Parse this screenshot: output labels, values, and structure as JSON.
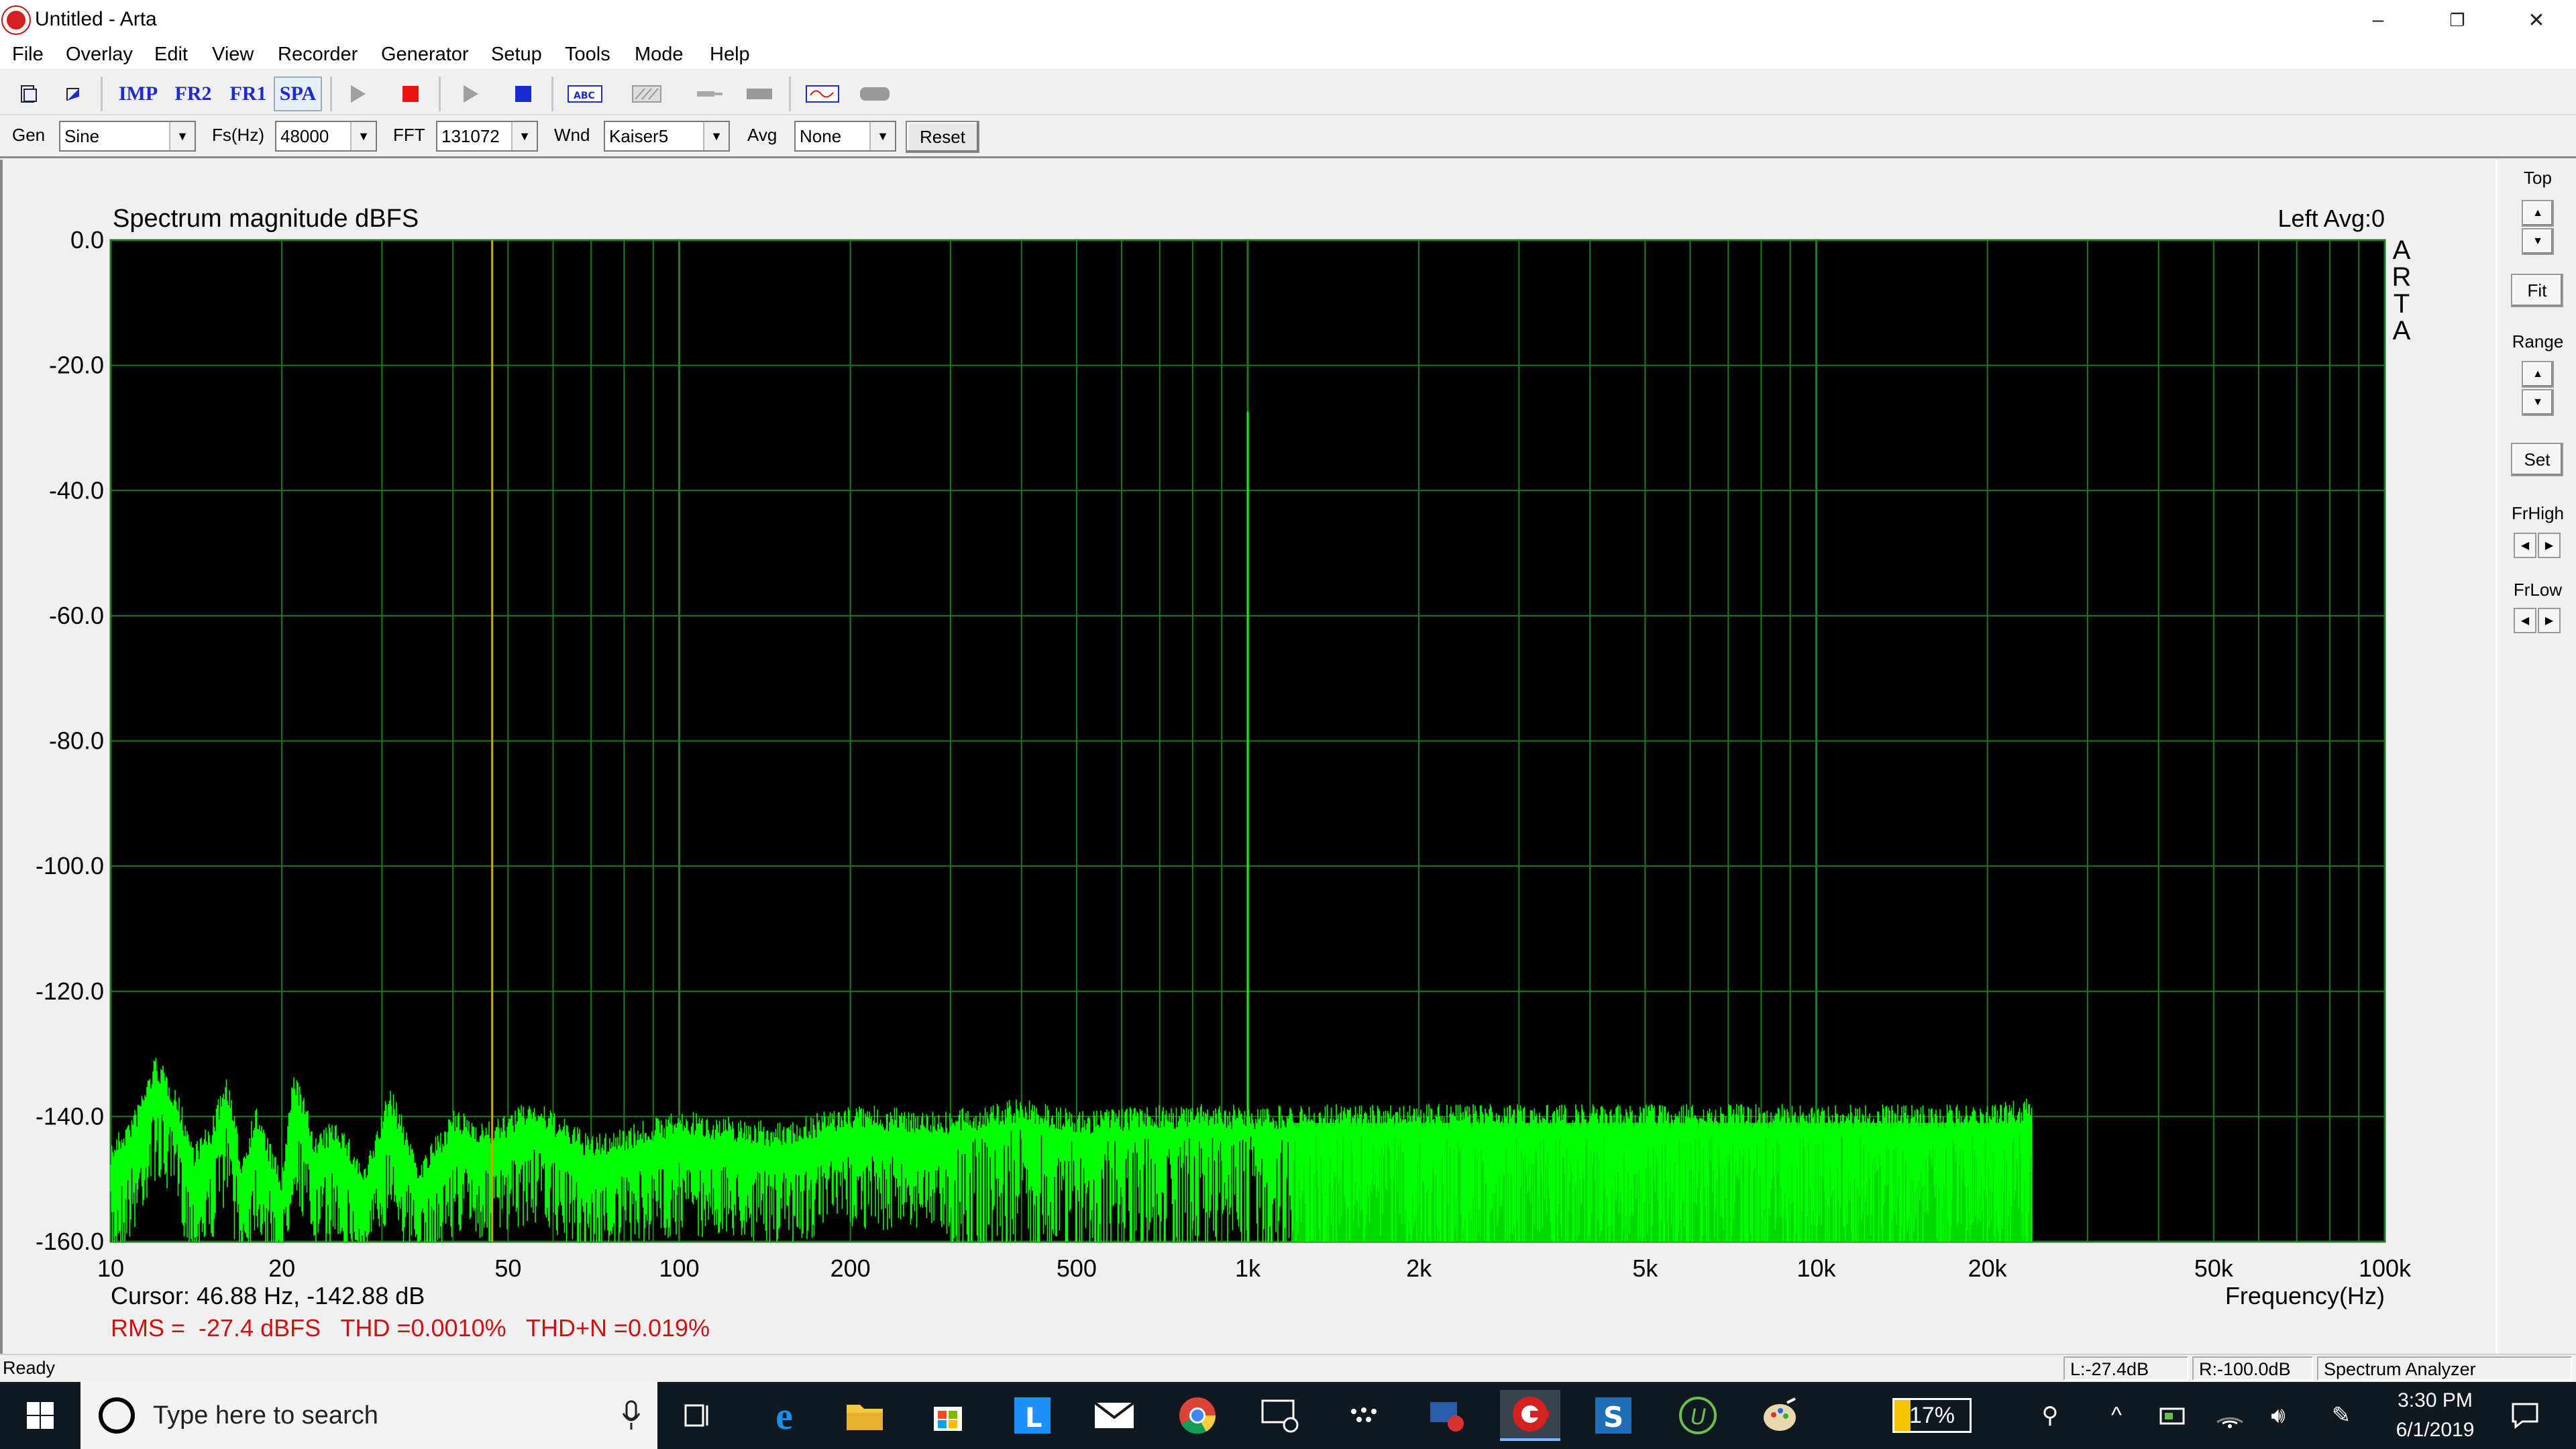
{
  "window": {
    "title": "Untitled - Arta",
    "minimize": "–",
    "restore": "❐",
    "close": "✕"
  },
  "menu": [
    "File",
    "Overlay",
    "Edit",
    "View",
    "Recorder",
    "Generator",
    "Setup",
    "Tools",
    "Mode",
    "Help"
  ],
  "toolbar": {
    "imp": "IMP",
    "fr2": "FR2",
    "fr1": "FR1",
    "spa": "SPA"
  },
  "params": {
    "gen_label": "Gen",
    "gen_value": "Sine",
    "fs_label": "Fs(Hz)",
    "fs_value": "48000",
    "fft_label": "FFT",
    "fft_value": "131072",
    "wnd_label": "Wnd",
    "wnd_value": "Kaiser5",
    "avg_label": "Avg",
    "avg_value": "None",
    "reset_label": "Reset"
  },
  "plot": {
    "title": "Spectrum magnitude dBFS",
    "channel_info": "Left  Avg:0",
    "brand_letters": [
      "A",
      "R",
      "T",
      "A"
    ],
    "cursor_text": "Cursor: 46.88 Hz, -142.88 dB",
    "stats_text": "RMS =  -27.4 dBFS   THD =0.0010%   THD+N =0.019%",
    "freq_axis_label": "Frequency(Hz)",
    "colors": {
      "background": "#000000",
      "grid": "#1e7a1e",
      "trace": "#00ff00",
      "cursor": "#c8a800",
      "stats": "#d01010"
    }
  },
  "chart_data": {
    "type": "line",
    "title": "Spectrum magnitude dBFS",
    "xlabel": "Frequency(Hz)",
    "ylabel": "",
    "xscale": "log",
    "xlim": [
      10,
      100000
    ],
    "ylim": [
      -160,
      0
    ],
    "y_ticks": [
      "0.0",
      "-20.0",
      "-40.0",
      "-60.0",
      "-80.0",
      "-100.0",
      "-120.0",
      "-140.0",
      "-160.0"
    ],
    "x_ticks": [
      {
        "v": 10,
        "label": "10"
      },
      {
        "v": 20,
        "label": "20"
      },
      {
        "v": 50,
        "label": "50"
      },
      {
        "v": 100,
        "label": "100"
      },
      {
        "v": 200,
        "label": "200"
      },
      {
        "v": 500,
        "label": "500"
      },
      {
        "v": 1000,
        "label": "1k"
      },
      {
        "v": 2000,
        "label": "2k"
      },
      {
        "v": 5000,
        "label": "5k"
      },
      {
        "v": 10000,
        "label": "10k"
      },
      {
        "v": 20000,
        "label": "20k"
      },
      {
        "v": 50000,
        "label": "50k"
      },
      {
        "v": 100000,
        "label": "100k"
      }
    ],
    "cursor": {
      "x": 46.88,
      "y": -142.88
    },
    "series": [
      {
        "values": [
          [
            10,
            -146
          ],
          [
            11,
            -141
          ],
          [
            12,
            -132
          ],
          [
            13,
            -137
          ],
          [
            14,
            -146
          ],
          [
            15,
            -143
          ],
          [
            16,
            -135
          ],
          [
            17,
            -148
          ],
          [
            18,
            -140
          ],
          [
            20,
            -151
          ],
          [
            21,
            -134
          ],
          [
            23,
            -145
          ],
          [
            25,
            -142
          ],
          [
            28,
            -150
          ],
          [
            31,
            -137
          ],
          [
            35,
            -149
          ],
          [
            40,
            -141
          ],
          [
            46.88,
            -142.9
          ],
          [
            55,
            -139
          ],
          [
            70,
            -145
          ],
          [
            100,
            -141
          ],
          [
            150,
            -143
          ],
          [
            200,
            -140
          ],
          [
            300,
            -141
          ],
          [
            400,
            -139
          ],
          [
            500,
            -141
          ],
          [
            700,
            -140
          ],
          [
            1000,
            -140
          ],
          [
            1500,
            -140
          ],
          [
            2000,
            -140
          ],
          [
            3000,
            -140
          ],
          [
            5000,
            -140
          ],
          [
            7000,
            -140
          ],
          [
            10000,
            -140
          ],
          [
            15000,
            -140
          ],
          [
            20000,
            -140
          ],
          [
            24000,
            -139
          ]
        ]
      }
    ],
    "peaks": [
      {
        "x": 1000,
        "y": -27.4
      }
    ]
  },
  "right_panel": {
    "top": "Top",
    "fit": "Fit",
    "range": "Range",
    "set": "Set",
    "frhigh": "FrHigh",
    "frlow": "FrLow"
  },
  "status": {
    "ready": "Ready",
    "l": "L:-27.4dB",
    "r": "R:-100.0dB",
    "mode": "Spectrum Analyzer"
  },
  "taskbar": {
    "search_placeholder": "Type here to search",
    "battery": "17%",
    "time": "3:30 PM",
    "date": "6/1/2019"
  }
}
